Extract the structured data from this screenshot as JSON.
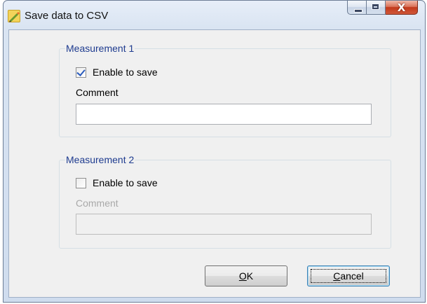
{
  "window": {
    "title": "Save data to CSV",
    "icon": "pencil-icon"
  },
  "caption_buttons": {
    "minimize_icon": "minimize-icon",
    "maximize_icon": "maximize-icon",
    "close_icon": "close-icon",
    "close_glyph": "X"
  },
  "groups": [
    {
      "title": "Measurement 1",
      "checkbox_label": "Enable to save",
      "checked": true,
      "comment_label": "Comment",
      "comment_value": "",
      "enabled": true
    },
    {
      "title": "Measurement 2",
      "checkbox_label": "Enable to save",
      "checked": false,
      "comment_label": "Comment",
      "comment_value": "",
      "enabled": false
    }
  ],
  "buttons": {
    "ok": {
      "accel": "O",
      "rest": "K"
    },
    "cancel": {
      "accel": "C",
      "rest": "ancel"
    }
  },
  "colors": {
    "group_title": "#1e3b8f",
    "close_button": "#c2391b",
    "checkmark": "#2a5bbd"
  }
}
